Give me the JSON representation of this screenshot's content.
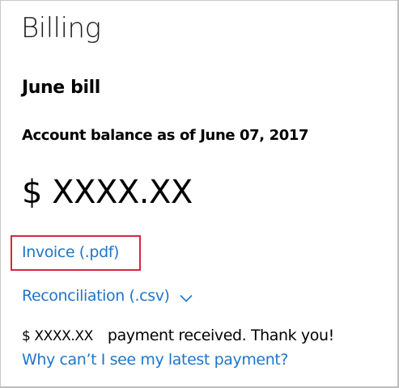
{
  "page": {
    "title": "Billing"
  },
  "bill": {
    "title": "June bill",
    "balance_label": "Account balance as of June 07, 2017",
    "balance_amount": "$ XXXX.XX"
  },
  "links": {
    "invoice": "Invoice (.pdf)",
    "reconciliation": "Reconciliation (.csv)",
    "reconciliation_icon": "chevron-down-icon",
    "latest_payment": "Why can’t I see my latest payment?"
  },
  "payment": {
    "amount": "$ XXXX.XX",
    "message": "payment received. Thank you!"
  },
  "colors": {
    "link": "#1f76c9",
    "highlight_border": "#d7263d",
    "text": "#000000"
  }
}
